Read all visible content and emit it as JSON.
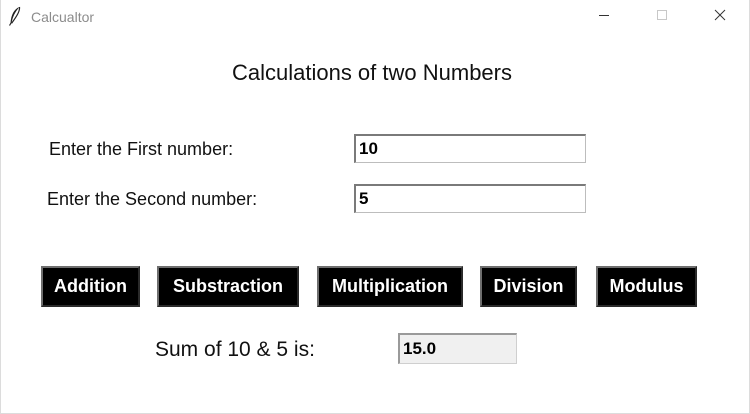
{
  "window": {
    "title": "Calcualtor",
    "icons": {
      "app": "feather-icon",
      "minimize": "minimize-icon",
      "maximize": "maximize-icon",
      "close": "close-icon"
    }
  },
  "main": {
    "heading": "Calculations of two Numbers",
    "first_label": "Enter the First number:",
    "first_value": "10",
    "second_label": "Enter the Second number:",
    "second_value": "5"
  },
  "buttons": {
    "addition": "Addition",
    "subtraction": "Substraction",
    "multiplication": "Multiplication",
    "division": "Division",
    "modulus": "Modulus"
  },
  "result": {
    "label": "Sum of 10 & 5 is:",
    "value": "15.0"
  },
  "colors": {
    "button_bg": "#000000",
    "button_text": "#ffffff",
    "result_bg": "#f0f0f0"
  }
}
